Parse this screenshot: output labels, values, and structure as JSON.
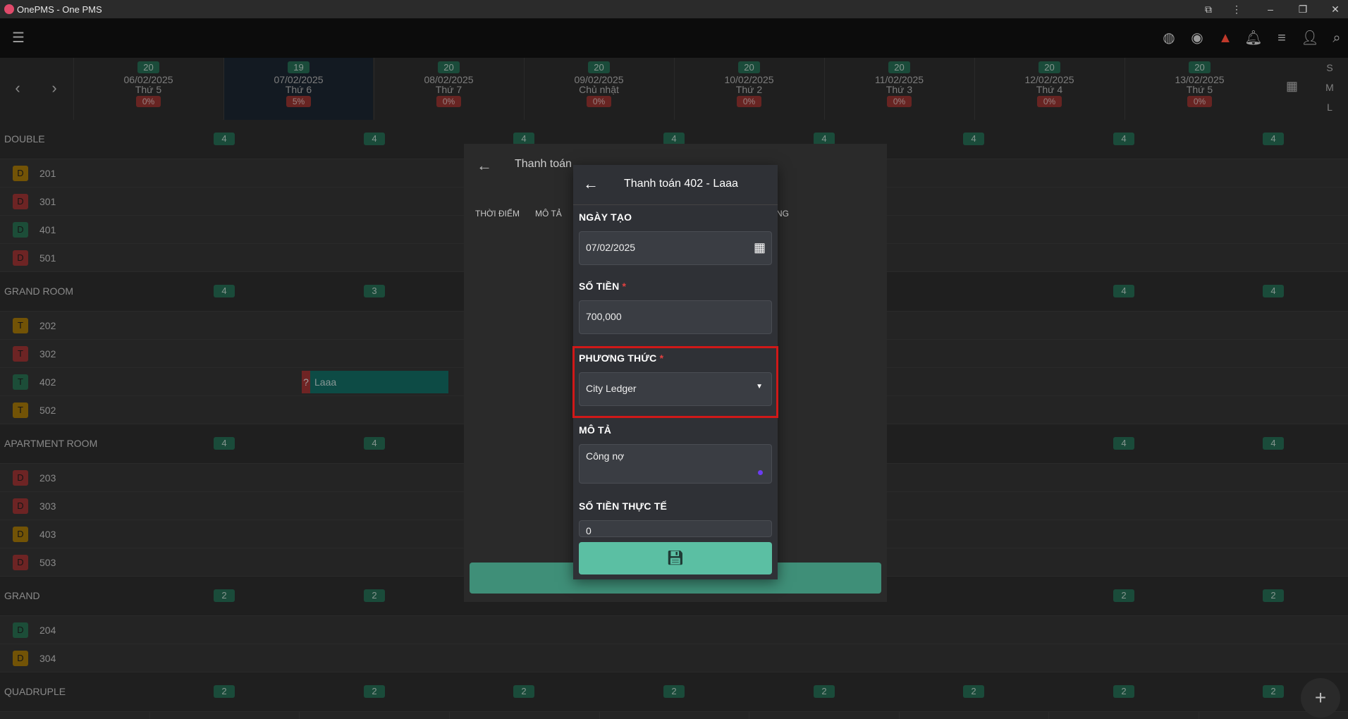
{
  "window": {
    "title": "OnePMS - One PMS"
  },
  "toolbar": {
    "menu_icon": "hamburger-icon",
    "icons": [
      "globe-icon",
      "eye-icon",
      "warning-icon",
      "bell-icon",
      "list-icon",
      "add-user-icon",
      "search-icon"
    ]
  },
  "calendar": {
    "days": [
      {
        "avail": "20",
        "date": "06/02/2025",
        "dow": "Thứ 5",
        "occ": "0%"
      },
      {
        "avail": "19",
        "date": "07/02/2025",
        "dow": "Thứ 6",
        "occ": "5%"
      },
      {
        "avail": "20",
        "date": "08/02/2025",
        "dow": "Thứ 7",
        "occ": "0%"
      },
      {
        "avail": "20",
        "date": "09/02/2025",
        "dow": "Chủ nhật",
        "occ": "0%"
      },
      {
        "avail": "20",
        "date": "10/02/2025",
        "dow": "Thứ 2",
        "occ": "0%"
      },
      {
        "avail": "20",
        "date": "11/02/2025",
        "dow": "Thứ 3",
        "occ": "0%"
      },
      {
        "avail": "20",
        "date": "12/02/2025",
        "dow": "Thứ 4",
        "occ": "0%"
      },
      {
        "avail": "20",
        "date": "13/02/2025",
        "dow": "Thứ 5",
        "occ": "0%"
      }
    ],
    "sizes": [
      "S",
      "M",
      "L"
    ]
  },
  "room_types": [
    {
      "name": "DOUBLE",
      "counts": [
        "4",
        "4",
        "4",
        "4",
        "4",
        "4",
        "4",
        "4",
        "4"
      ],
      "rooms": [
        {
          "tag": "D",
          "num": "201",
          "color": "#b8860b"
        },
        {
          "tag": "D",
          "num": "301",
          "color": "#b03a3a"
        },
        {
          "tag": "D",
          "num": "401",
          "color": "#2e7d5b"
        },
        {
          "tag": "D",
          "num": "501",
          "color": "#b03a3a"
        }
      ]
    },
    {
      "name": "GRAND ROOM",
      "counts": [
        "4",
        "3",
        "",
        "",
        "",
        "",
        "4",
        "4",
        "4"
      ],
      "rooms": [
        {
          "tag": "T",
          "num": "202",
          "color": "#b8860b"
        },
        {
          "tag": "T",
          "num": "302",
          "color": "#b03a3a"
        },
        {
          "tag": "T",
          "num": "402",
          "color": "#2e7d5b"
        },
        {
          "tag": "T",
          "num": "502",
          "color": "#b8860b"
        }
      ]
    },
    {
      "name": "APARTMENT ROOM",
      "counts": [
        "4",
        "4",
        "",
        "",
        "",
        "",
        "4",
        "4",
        "4"
      ],
      "rooms": [
        {
          "tag": "D",
          "num": "203",
          "color": "#b03a3a"
        },
        {
          "tag": "D",
          "num": "303",
          "color": "#b03a3a"
        },
        {
          "tag": "D",
          "num": "403",
          "color": "#b8860b"
        },
        {
          "tag": "D",
          "num": "503",
          "color": "#b03a3a"
        }
      ]
    },
    {
      "name": "GRAND",
      "counts": [
        "2",
        "2",
        "",
        "",
        "",
        "",
        "2",
        "2",
        "2"
      ],
      "rooms": [
        {
          "tag": "D",
          "num": "204",
          "color": "#2e7d5b"
        },
        {
          "tag": "D",
          "num": "304",
          "color": "#b8860b"
        }
      ]
    },
    {
      "name": "QUADRUPLE",
      "counts": [
        "2",
        "2",
        "2",
        "2",
        "2",
        "2",
        "2",
        "2",
        "2"
      ],
      "rooms": []
    }
  ],
  "booking": {
    "flag": "?",
    "guest": "Laaa"
  },
  "outer_dialog": {
    "title": "Thanh toán",
    "columns": [
      "THỜI ĐIỂM",
      "MÔ TẢ",
      "NG"
    ]
  },
  "payment_dialog": {
    "title": "Thanh toán 402 - Laaa",
    "created_label": "NGÀY TẠO",
    "created_value": "07/02/2025",
    "amount_label": "SỐ TIỀN",
    "amount_value": "700,000",
    "method_label": "PHƯƠNG THỨC",
    "method_value": "City Ledger",
    "desc_label": "MÔ TẢ",
    "desc_value": "Công nợ",
    "actual_label": "SỐ TIỀN THỰC TẾ",
    "actual_value": "0",
    "required_mark": "*"
  },
  "fab": {
    "label": "+"
  }
}
